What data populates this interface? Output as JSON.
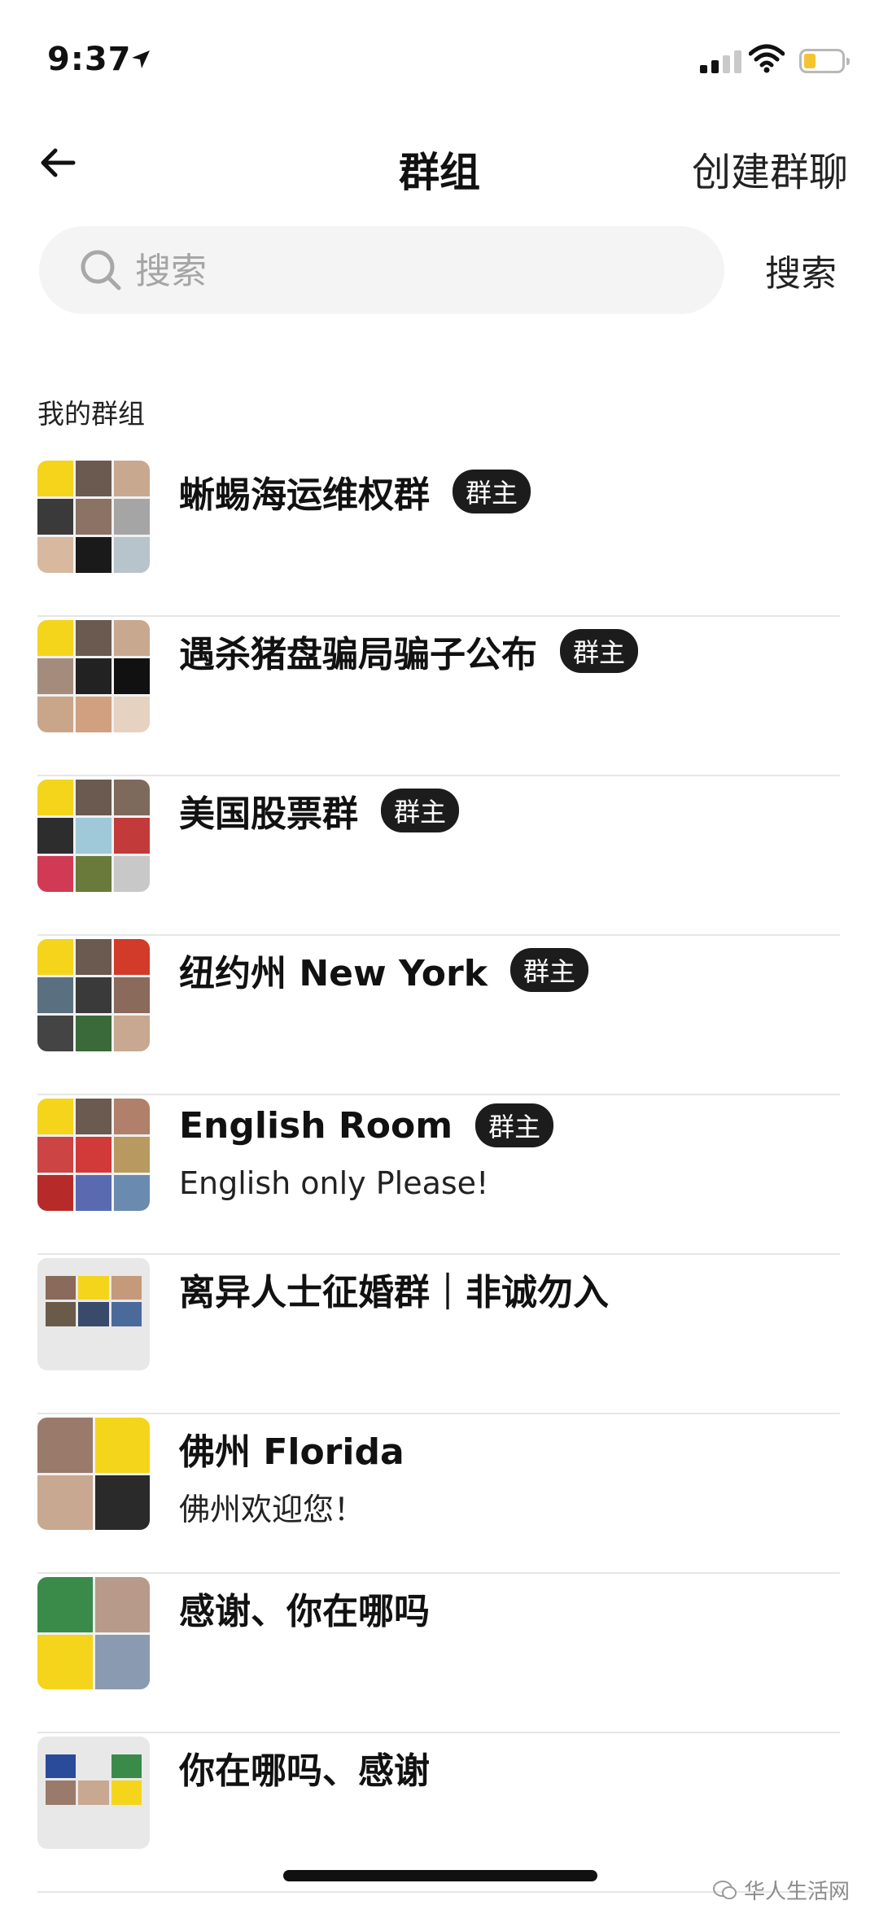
{
  "status_bar": {
    "time": "9:37"
  },
  "header": {
    "title": "群组",
    "create_label": "创建群聊"
  },
  "search": {
    "placeholder": "搜索",
    "button_label": "搜索"
  },
  "section_title": "我的群组",
  "groups": [
    {
      "name": "蜥蜴海运维权群",
      "badge": "群主",
      "desc": ""
    },
    {
      "name": "遇杀猪盘骗局骗子公布",
      "badge": "群主",
      "desc": ""
    },
    {
      "name": "美国股票群",
      "badge": "群主",
      "desc": ""
    },
    {
      "name": "纽约州 New York",
      "badge": "群主",
      "desc": ""
    },
    {
      "name": "English Room",
      "badge": "群主",
      "desc": "English only Please!"
    },
    {
      "name": "离异人士征婚群｜非诚勿入",
      "badge": "",
      "desc": ""
    },
    {
      "name": "佛州 Florida",
      "badge": "",
      "desc": "佛州欢迎您！"
    },
    {
      "name": "感谢、你在哪吗",
      "badge": "",
      "desc": ""
    },
    {
      "name": "你在哪吗、感谢",
      "badge": "",
      "desc": ""
    }
  ],
  "watermark": "华人生活网",
  "colors": {
    "brand_yellow": "#f4d51c",
    "badge_bg": "#1c1c1c",
    "divider": "#e6e6e6"
  }
}
